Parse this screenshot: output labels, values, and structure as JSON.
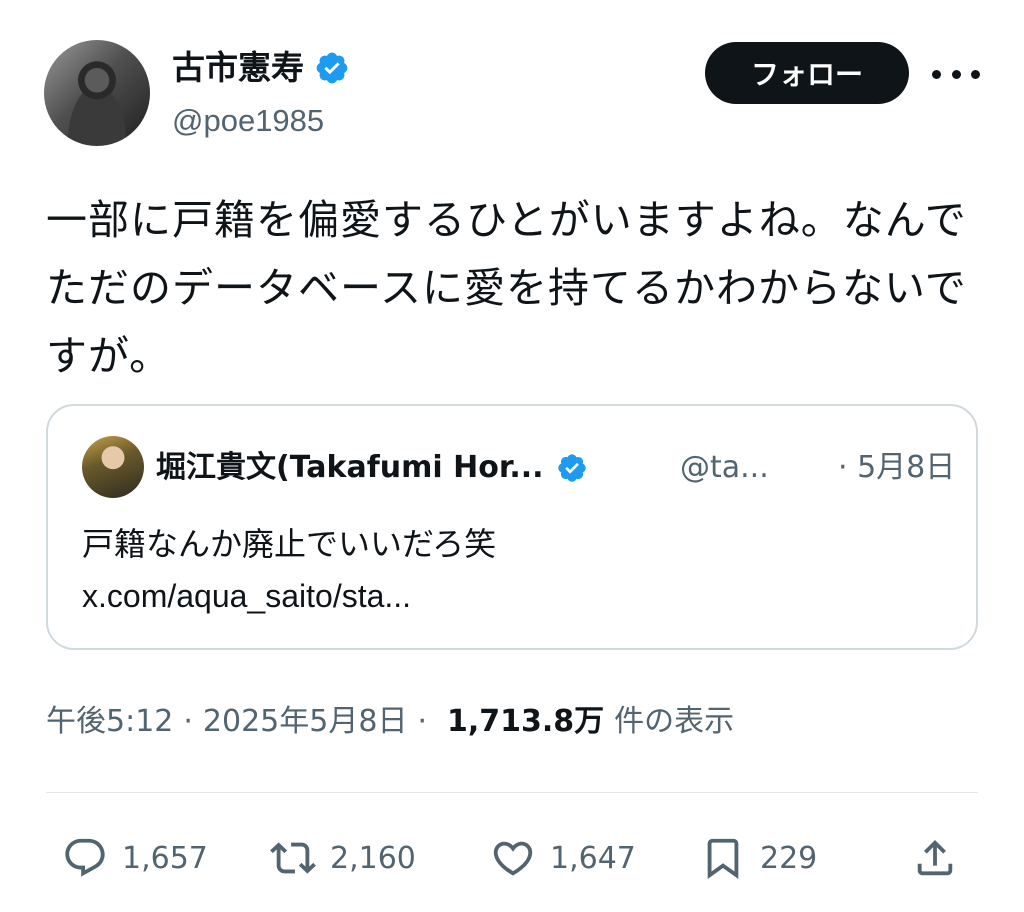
{
  "author": {
    "name": "古市憲寿",
    "handle": "@poe1985",
    "follow_label": "フォロー"
  },
  "tweet": {
    "text": "一部に戸籍を偏愛するひとがいますよね。なんで\nただのデータベースに愛を持てるかわからないで\nすが。"
  },
  "quote": {
    "name": "堀江貴文(Takafumi Hor...",
    "handle": "@ta...",
    "date": "· 5月8日",
    "text": "戸籍なんか廃止でいいだろ笑",
    "link": "x.com/aqua_saito/sta..."
  },
  "meta": {
    "time": "午後5:12",
    "separator": "·",
    "date": "2025年5月8日",
    "views": "1,713.8万",
    "views_label": "件の表示"
  },
  "actions": {
    "replies": "1,657",
    "reposts": "2,160",
    "likes": "1,647",
    "bookmarks": "229"
  },
  "colors": {
    "verified": "#1d9bf0",
    "text_primary": "#0f1419",
    "text_secondary": "#536471",
    "border": "#cfd9de"
  },
  "icons": {
    "verified": "verified-badge-icon",
    "reply": "reply-icon",
    "repost": "repost-icon",
    "like": "heart-icon",
    "bookmark": "bookmark-icon",
    "share": "share-icon",
    "more": "more-icon"
  }
}
